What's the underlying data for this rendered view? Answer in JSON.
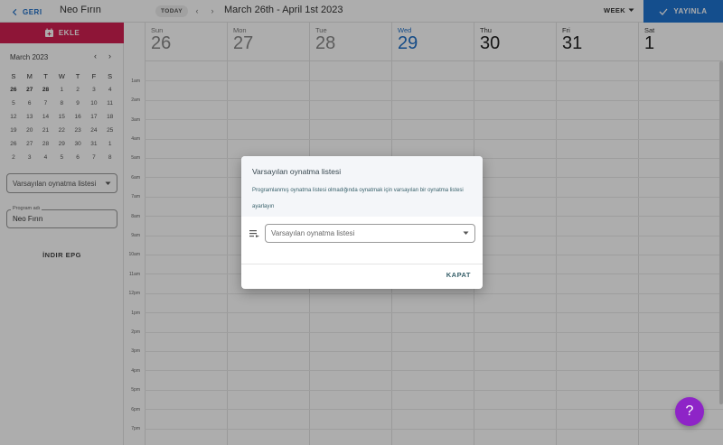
{
  "header": {
    "back_label": "GERI",
    "channel_title": "Neo Fırın",
    "today_label": "TODAY",
    "date_range": "March 26th - April 1st 2023",
    "view_label": "WEEK",
    "publish_label": "YAYINLA",
    "accent_color": "#1e73d0"
  },
  "sidebar": {
    "add_label": "EKLE",
    "add_color": "#d11f52",
    "mini_calendar": {
      "title": "March 2023",
      "weekdays": [
        "S",
        "M",
        "T",
        "W",
        "T",
        "F",
        "S"
      ],
      "weeks": [
        [
          "26",
          "27",
          "28",
          "1",
          "2",
          "3",
          "4"
        ],
        [
          "5",
          "6",
          "7",
          "8",
          "9",
          "10",
          "11"
        ],
        [
          "12",
          "13",
          "14",
          "15",
          "16",
          "17",
          "18"
        ],
        [
          "19",
          "20",
          "21",
          "22",
          "23",
          "24",
          "25"
        ],
        [
          "26",
          "27",
          "28",
          "29",
          "30",
          "31",
          "1"
        ],
        [
          "2",
          "3",
          "4",
          "5",
          "6",
          "7",
          "8"
        ]
      ]
    },
    "playlist_select_value": "Varsayılan oynatma listesi",
    "program_field": {
      "label": "Program adı",
      "value": "Neo Fırın"
    },
    "epg_label": "İNDIR EPG"
  },
  "calendar": {
    "days": [
      {
        "name": "Sun",
        "num": "26"
      },
      {
        "name": "Mon",
        "num": "27"
      },
      {
        "name": "Tue",
        "num": "28"
      },
      {
        "name": "Wed",
        "num": "29"
      },
      {
        "name": "Thu",
        "num": "30"
      },
      {
        "name": "Fri",
        "num": "31"
      },
      {
        "name": "Sat",
        "num": "1"
      }
    ],
    "hours": [
      "1am",
      "2am",
      "3am",
      "4am",
      "5am",
      "6am",
      "7am",
      "8am",
      "9am",
      "10am",
      "11am",
      "12pm",
      "1pm",
      "2pm",
      "3pm",
      "4pm",
      "5pm",
      "6pm",
      "7pm"
    ]
  },
  "dialog": {
    "title": "Varsayılan oynatma listesi",
    "description": "Programlanmış oynatma listesi olmadığında oynatmak için varsayılan bir oynatma listesi ayarlayın",
    "select_placeholder": "Varsayılan oynatma listesi",
    "close_label": "KAPAT"
  },
  "help_button": {
    "label": "?",
    "color": "#8e24c7"
  }
}
